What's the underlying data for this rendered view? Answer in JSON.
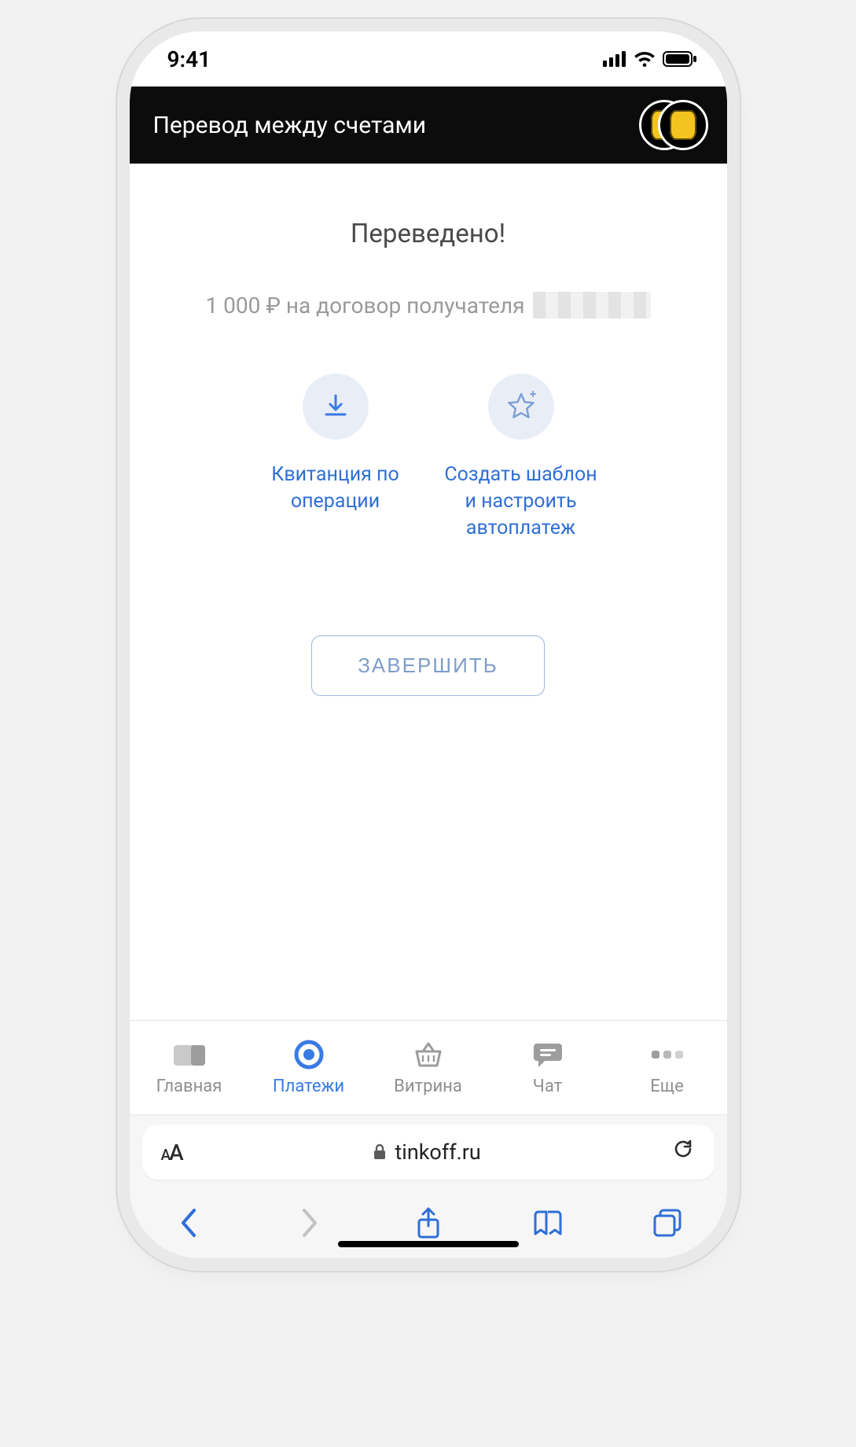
{
  "status": {
    "time": "9:41"
  },
  "header": {
    "title": "Перевод между счетами"
  },
  "main": {
    "title": "Переведено!",
    "subtitle_prefix": "1 000 ₽ на договор получателя"
  },
  "actions": {
    "receipt": {
      "label": "Квитанция по операции"
    },
    "template": {
      "label": "Создать шаблон и настроить автоплатеж"
    }
  },
  "button": {
    "finish": "ЗАВЕРШИТЬ"
  },
  "nav": {
    "items": [
      {
        "label": "Главная"
      },
      {
        "label": "Платежи"
      },
      {
        "label": "Витрина"
      },
      {
        "label": "Чат"
      },
      {
        "label": "Еще"
      }
    ]
  },
  "browser": {
    "url": "tinkoff.ru"
  }
}
